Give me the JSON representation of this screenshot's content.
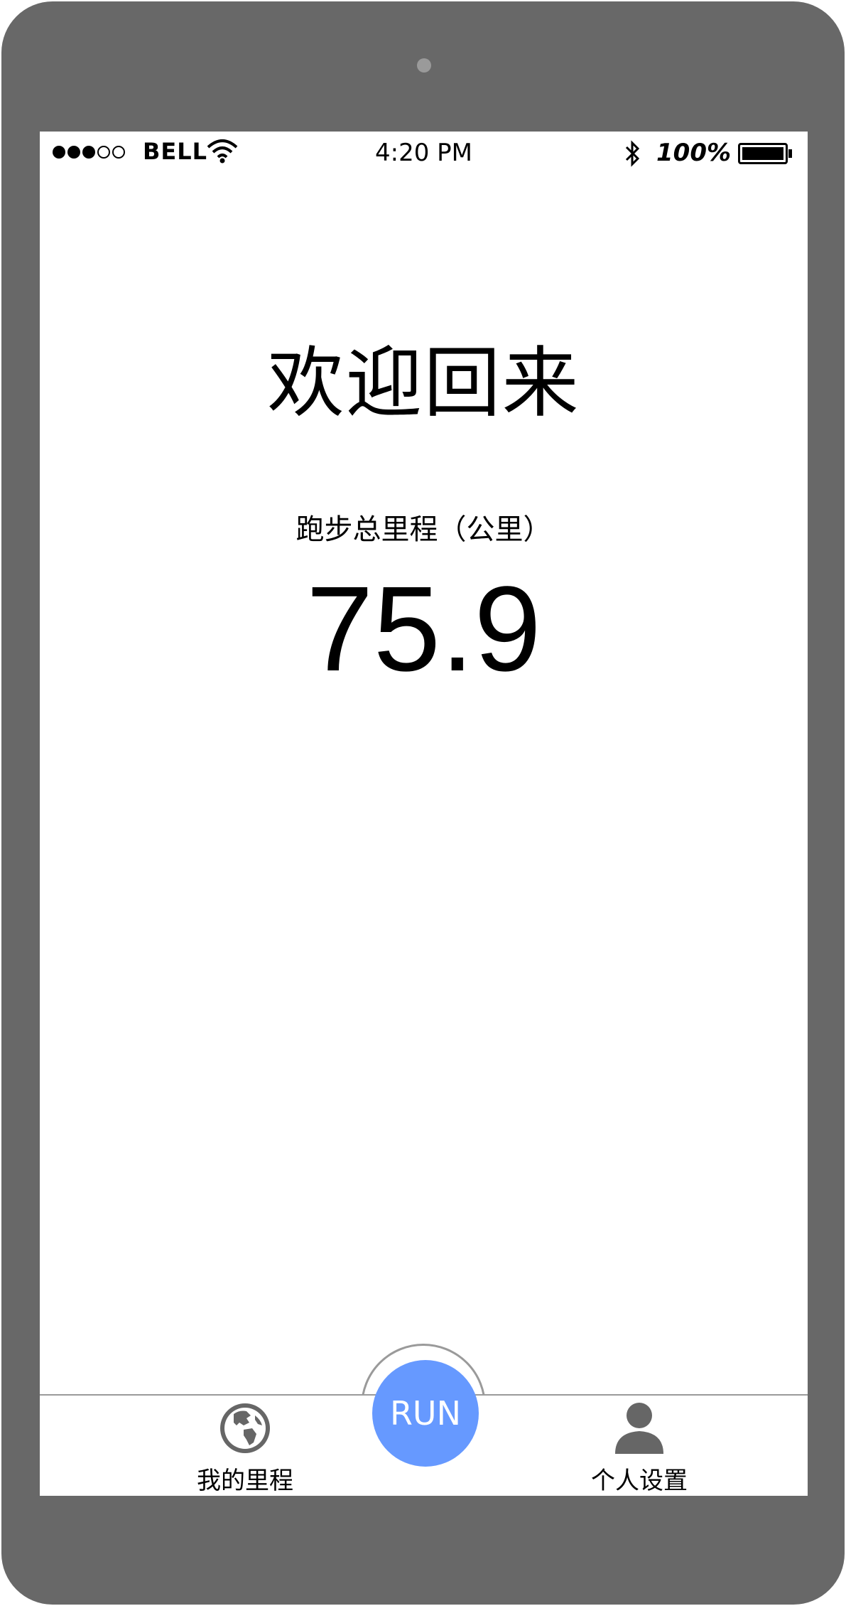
{
  "status_bar": {
    "carrier": "BELL",
    "time": "4:20 PM",
    "battery_percent": "100%",
    "signal_strength": 3,
    "signal_max": 5,
    "icons": [
      "signal-dots-icon",
      "wifi-icon",
      "bluetooth-icon",
      "battery-icon"
    ]
  },
  "main": {
    "welcome_title": "欢迎回来",
    "metric_label": "跑步总里程（公里）",
    "metric_value": "75.9"
  },
  "tab_bar": {
    "run_label": "RUN",
    "tabs": [
      {
        "label": "我的里程",
        "icon": "globe-icon"
      },
      {
        "label": "个人设置",
        "icon": "user-icon"
      }
    ]
  },
  "colors": {
    "device_frame": "#686868",
    "run_button": "#6699ff",
    "divider": "#9a9a9a"
  }
}
